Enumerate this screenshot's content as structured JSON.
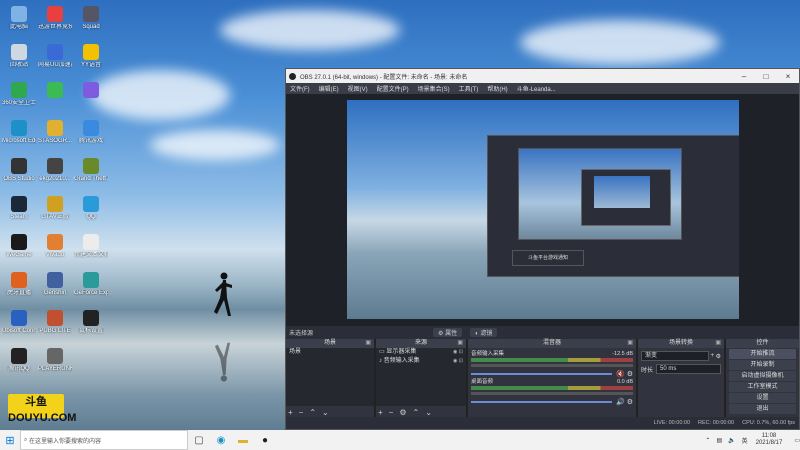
{
  "desktop_icons": [
    {
      "label": "此电脑",
      "color": "#7fb3e6"
    },
    {
      "label": "迅游世界竞技平台",
      "color": "#e64040"
    },
    {
      "label": "Squad",
      "color": "#556"
    },
    {
      "label": "回收站",
      "color": "#cfd8e0"
    },
    {
      "label": "网易UU加速器",
      "color": "#3a6ad6"
    },
    {
      "label": "YY语音",
      "color": "#f2c200"
    },
    {
      "label": "360安全卫士",
      "color": "#2fa84f"
    },
    {
      "label": "",
      "color": "#3cba54"
    },
    {
      "label": "",
      "color": "#7d5ce0"
    },
    {
      "label": "Microsoft Edge",
      "color": "#1e90c8"
    },
    {
      "label": "STASOGR...",
      "color": "#e0b030"
    },
    {
      "label": "腾讯游戏",
      "color": "#3a8ae0"
    },
    {
      "label": "OBS Studio",
      "color": "#333"
    },
    {
      "label": "ekg20210...",
      "color": "#444"
    },
    {
      "label": "Grand Theft Auto V",
      "color": "#6a8a2a"
    },
    {
      "label": "Steam",
      "color": "#1b2838"
    },
    {
      "label": "GTAV正版",
      "color": "#d0a020"
    },
    {
      "label": "QQ",
      "color": "#2a9ad8"
    },
    {
      "label": "WeGame",
      "color": "#1a1a1a"
    },
    {
      "label": "Vivado",
      "color": "#e08030"
    },
    {
      "label": "新建文本文档",
      "color": "#ececec"
    },
    {
      "label": "虎牙直播",
      "color": "#e06020"
    },
    {
      "label": "Genshin",
      "color": "#4060a0"
    },
    {
      "label": "GeForce Experience",
      "color": "#2a9a9a"
    },
    {
      "label": "Ubisoft Connect",
      "color": "#2a60c0"
    },
    {
      "label": "PUBG LITE",
      "color": "#c05030"
    },
    {
      "label": "鼠标设置",
      "color": "#222"
    },
    {
      "label": "腾讯QQ",
      "color": "#222"
    },
    {
      "label": "PLAYERUNKNOWN'S BATTLEG...",
      "color": "#666"
    }
  ],
  "watermark": "斗鱼 DOUYU.COM",
  "obs": {
    "title": "OBS 27.0.1 (64-bit, windows) - 配置文件: 未命名 - 场景: 未命名",
    "menu": [
      "文件(F)",
      "编辑(E)",
      "视图(V)",
      "配置文件(P)",
      "场景集合(S)",
      "工具(T)",
      "帮助(H)",
      "斗鱼-Leanda..."
    ],
    "preview_toast": "斗鱼平台游戏通知",
    "context": {
      "no_source": "未选择源",
      "properties": "属性",
      "filters": "滤镜"
    },
    "docks": {
      "scenes": {
        "title": "场景",
        "items": [
          "场景"
        ]
      },
      "sources": {
        "title": "来源",
        "items": [
          "显示器采集",
          "音频输入采集"
        ]
      },
      "mixer": {
        "title": "混音器",
        "tracks": [
          {
            "name": "音频输入采集",
            "db": "-12.5 dB"
          },
          {
            "name": "桌面音频",
            "db": "0.0 dB"
          }
        ]
      },
      "transitions": {
        "title": "场景转换",
        "type": "渐变",
        "duration_label": "时长",
        "duration": "50 ms"
      },
      "controls": {
        "title": "控件",
        "buttons": [
          "开始推流",
          "开始录制",
          "启动虚拟摄像机",
          "工作室模式",
          "设置",
          "退出"
        ]
      }
    },
    "status": {
      "live": "LIVE: 00:00:00",
      "rec": "REC: 00:00:00",
      "cpu": "CPU: 0.7%, 60.00 fps"
    }
  },
  "taskbar": {
    "search_placeholder": "在这里输入你要搜索的内容",
    "time": "11:08",
    "date": "2021/8/17",
    "lang": "英"
  }
}
